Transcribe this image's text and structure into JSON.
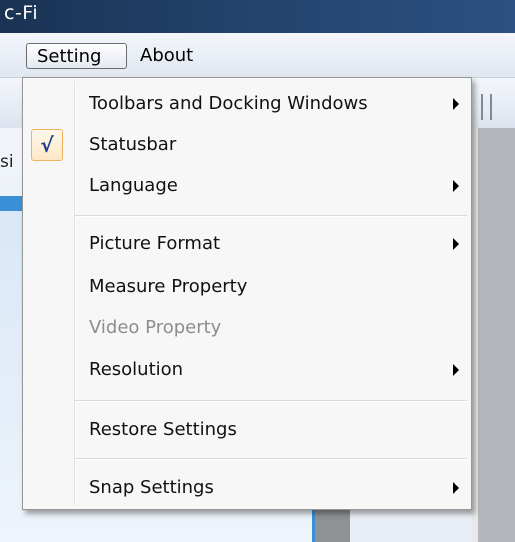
{
  "window": {
    "title_fragment": "c-Fi"
  },
  "menubar": {
    "setting": "Setting",
    "about": "About"
  },
  "side_text": "si",
  "menu": {
    "items": [
      {
        "label": "Toolbars and Docking Windows",
        "submenu": true,
        "checked": false,
        "enabled": true
      },
      {
        "label": "Statusbar",
        "submenu": false,
        "checked": true,
        "enabled": true,
        "check_glyph": "√"
      },
      {
        "label": "Language",
        "submenu": true,
        "checked": false,
        "enabled": true
      },
      {
        "label": "Picture Format",
        "submenu": true,
        "checked": false,
        "enabled": true
      },
      {
        "label": "Measure Property",
        "submenu": false,
        "checked": false,
        "enabled": true
      },
      {
        "label": "Video Property",
        "submenu": false,
        "checked": false,
        "enabled": false
      },
      {
        "label": "Resolution",
        "submenu": true,
        "checked": false,
        "enabled": true
      },
      {
        "label": "Restore Settings",
        "submenu": false,
        "checked": false,
        "enabled": true
      },
      {
        "label": "Snap Settings",
        "submenu": true,
        "checked": false,
        "enabled": true
      }
    ]
  },
  "colors": {
    "checkmark": "#1c3d8f",
    "check_highlight": "#f2b25e",
    "disabled_text": "#8d8d8d"
  }
}
